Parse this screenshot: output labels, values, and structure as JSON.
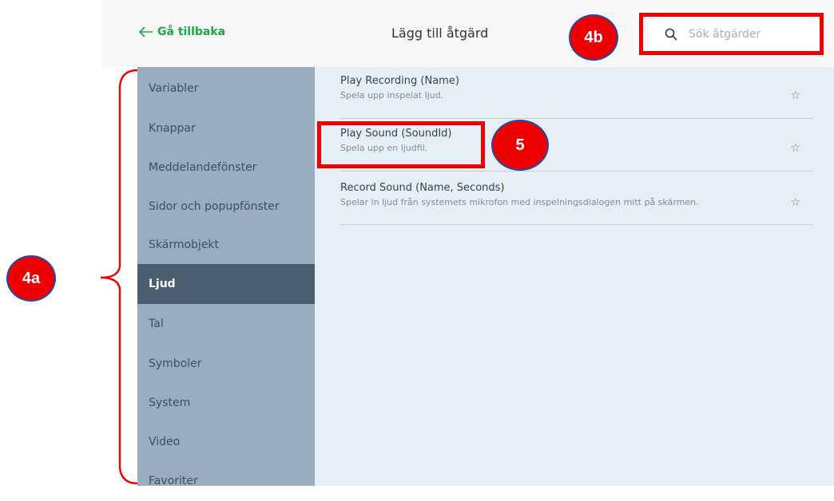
{
  "header": {
    "back_label": "Gå tillbaka",
    "title": "Lägg till åtgärd",
    "search_placeholder": "Sök åtgärder"
  },
  "sidebar": {
    "items": [
      {
        "label": "Variabler"
      },
      {
        "label": "Knappar"
      },
      {
        "label": "Meddelandefönster"
      },
      {
        "label": "Sidor och popupfönster"
      },
      {
        "label": "Skärmobjekt"
      },
      {
        "label": "Ljud",
        "active": true
      },
      {
        "label": "Tal"
      },
      {
        "label": "Symboler"
      },
      {
        "label": "System"
      },
      {
        "label": "Video"
      },
      {
        "label": "Favoriter"
      }
    ]
  },
  "actions": [
    {
      "name": "Play Recording (Name)",
      "description": "Spela upp inspelat ljud."
    },
    {
      "name": "Play Sound (SoundId)",
      "description": "Spela upp en ljudfil."
    },
    {
      "name": "Record Sound (Name, Seconds)",
      "description": "Spelar in ljud från systemets mikrofon med inspelningsdialogen mitt på skärmen."
    }
  ],
  "annotations": {
    "label_4a": "4a",
    "label_4b": "4b",
    "label_5": "5",
    "color": "#ee0000"
  },
  "colors": {
    "accent_green": "#1aa84a",
    "sidebar_bg": "#9aadbf",
    "sidebar_active": "#4b5e70",
    "content_bg": "#e6eef6"
  }
}
